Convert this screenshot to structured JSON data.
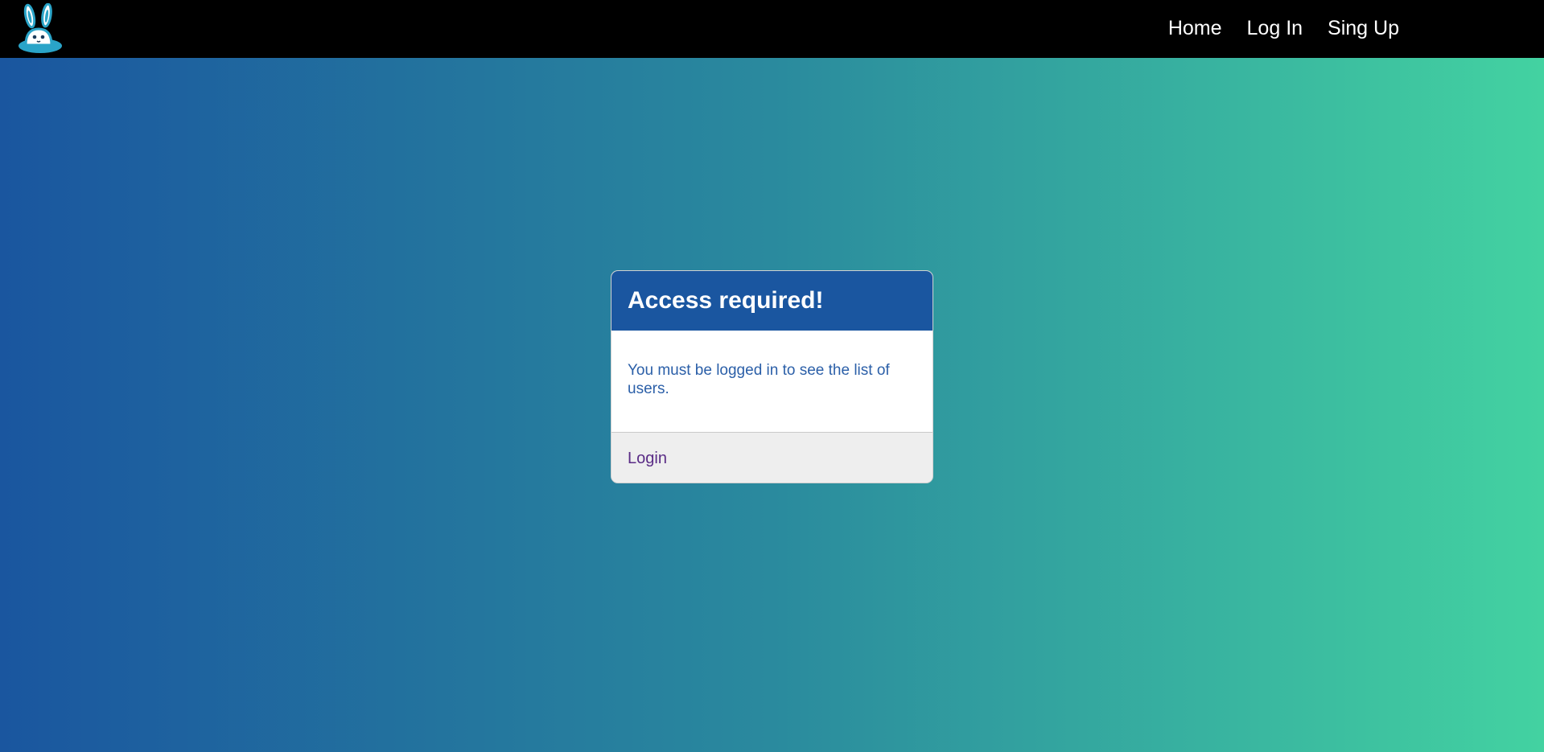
{
  "navbar": {
    "logo_icon": "rabbit-logo-icon",
    "links": [
      {
        "label": "Home"
      },
      {
        "label": "Log In"
      },
      {
        "label": "Sing Up"
      }
    ]
  },
  "card": {
    "title": "Access required!",
    "message": "You must be logged in to see the list of users.",
    "footer_link": "Login"
  },
  "colors": {
    "navbar_bg": "#000000",
    "gradient_start": "#1a569f",
    "gradient_end": "#43d2a1",
    "card_header_bg": "#1a56a0",
    "message_text": "#2b5fa8",
    "footer_bg": "#eeeeee",
    "footer_link": "#5a2c86"
  }
}
